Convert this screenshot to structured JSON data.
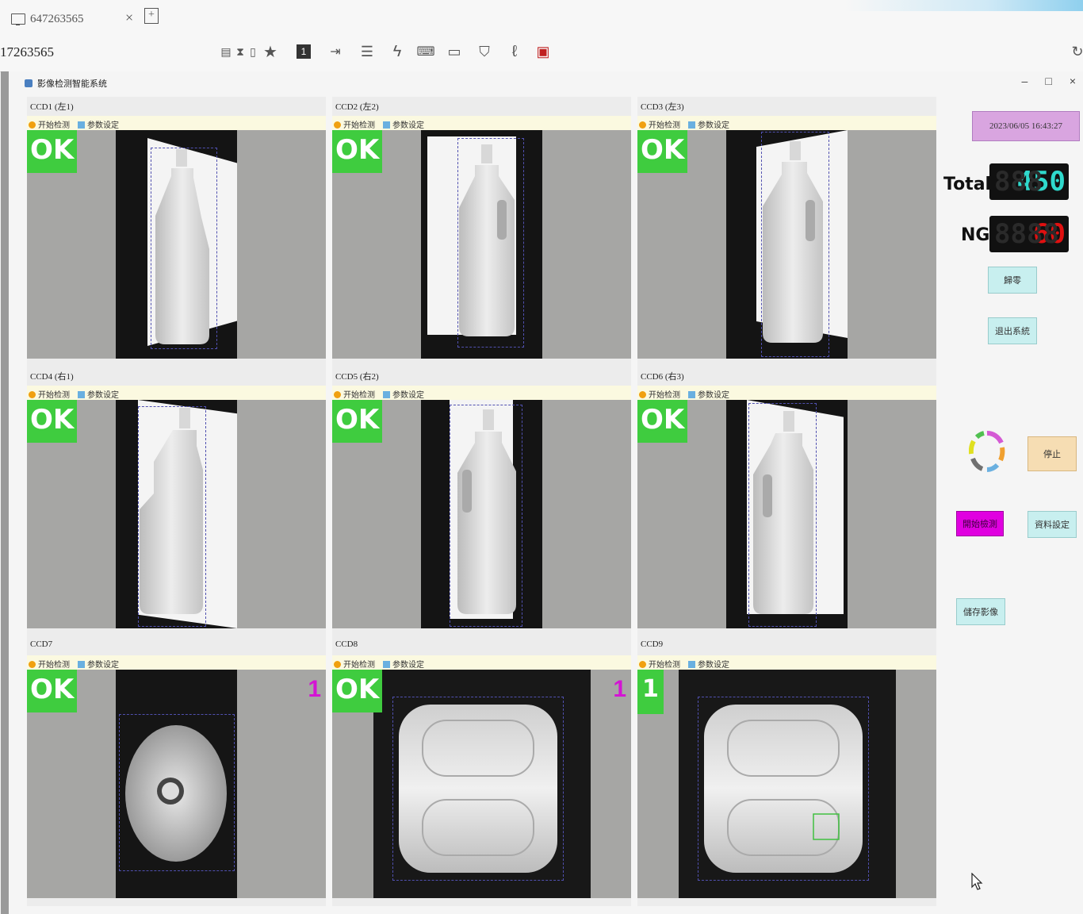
{
  "browser": {
    "tab_title": "647263565",
    "tab_close": "×",
    "new_tab": "+",
    "address": "17263565",
    "toolbar_icons": [
      "monitor-grid-icon",
      "hourglass-icon",
      "clipboard-icon",
      "star-icon",
      "page-one-icon",
      "export-icon",
      "chat-icon",
      "lightning-icon",
      "keyboard-icon",
      "display-icon",
      "shield-icon",
      "pen-icon",
      "record-icon"
    ],
    "page_number": "1"
  },
  "window": {
    "title": "影像检测智能系统",
    "controls": [
      "–",
      "□",
      "×"
    ]
  },
  "cameras": [
    {
      "label": "CCD1 (左1)",
      "result": "OK",
      "count": "",
      "toolbar": [
        "开始检测",
        "参数设定"
      ]
    },
    {
      "label": "CCD2 (左2)",
      "result": "OK",
      "count": "",
      "toolbar": [
        "开始检测",
        "参数设定"
      ]
    },
    {
      "label": "CCD3 (左3)",
      "result": "OK",
      "count": "",
      "toolbar": [
        "开始检测",
        "参数设定"
      ]
    },
    {
      "label": "CCD4 (右1)",
      "result": "OK",
      "count": "",
      "toolbar": [
        "开始检测",
        "参数设定"
      ]
    },
    {
      "label": "CCD5 (右2)",
      "result": "OK",
      "count": "",
      "toolbar": [
        "开始检测",
        "参数设定"
      ]
    },
    {
      "label": "CCD6 (右3)",
      "result": "OK",
      "count": "",
      "toolbar": [
        "开始检测",
        "参数设定"
      ]
    },
    {
      "label": "CCD7",
      "result": "OK",
      "count": "1",
      "toolbar": [
        "开始检测",
        "参数设定"
      ]
    },
    {
      "label": "CCD8",
      "result": "OK",
      "count": "1",
      "toolbar": [
        "开始检测",
        "参数设定"
      ]
    },
    {
      "label": "CCD9",
      "result": "1",
      "count": "",
      "toolbar": [
        "开始检测",
        "参数设定"
      ]
    }
  ],
  "panel": {
    "datetime": "2023/06/05 16:43:27",
    "total_label": "Total",
    "total_value": "450",
    "ng_label": "NG",
    "ng_value": "60",
    "btn_reset": "歸零",
    "btn_exit": "退出系統",
    "btn_stop": "停止",
    "btn_magenta": "開始檢測",
    "btn_material": "資料設定",
    "btn_save": "儲存影像"
  },
  "colors": {
    "ok_green": "#3fcc3f",
    "count_magenta": "#d414d4",
    "date_bg": "#d9a5e0",
    "total_digits": "#2fd9cc",
    "ng_digits": "#e01010",
    "panel_button": "#c8efef",
    "stop_button": "#f6ddb3",
    "magenta_button": "#e000e0"
  }
}
